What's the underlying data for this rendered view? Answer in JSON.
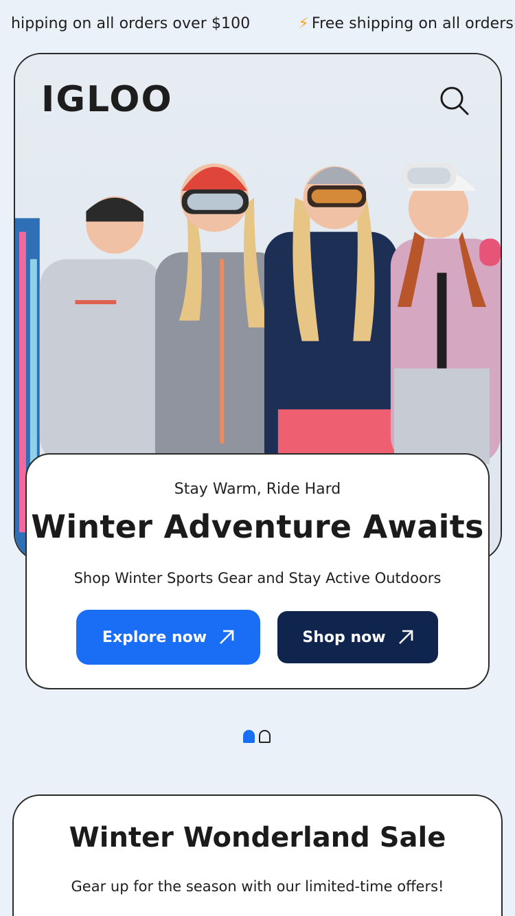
{
  "announcement": {
    "items": [
      "hipping on all orders over $100",
      "Free shipping on all orders"
    ],
    "icon": "lightning-bolt-icon",
    "bolt_glyph": "⚡",
    "bolt_color": "#f5a623"
  },
  "header": {
    "logo": "IGLOO",
    "search_icon": "search-icon"
  },
  "hero": {
    "image_description_icon": "hero-photo",
    "eyebrow": "Stay Warm, Ride Hard",
    "title": "Winter Adventure Awaits",
    "subtitle": "Shop Winter Sports Gear and Stay Active Outdoors",
    "buttons": {
      "explore_label": "Explore now",
      "shop_label": "Shop now",
      "arrow_icon": "arrow-up-right-icon"
    }
  },
  "carousel": {
    "active_index": 0,
    "count": 2
  },
  "sale": {
    "title": "Winter Wonderland Sale",
    "subtitle": "Gear up for the season with our limited-time offers!"
  },
  "colors": {
    "page_bg": "#ebf1f8",
    "accent_blue": "#1a6ef5",
    "navy": "#0f254e",
    "text": "#1b1b1b"
  }
}
